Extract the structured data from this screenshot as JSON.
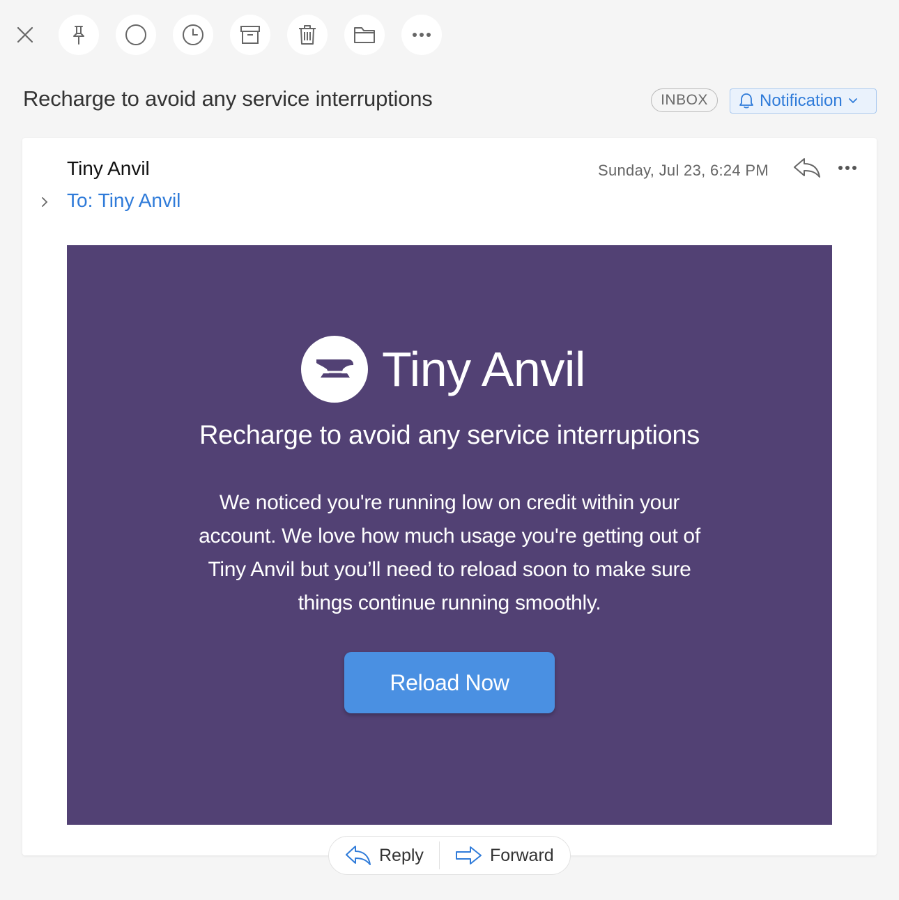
{
  "toolbar": {
    "icons": [
      "close-icon",
      "pin-icon",
      "circle-icon",
      "clock-icon",
      "archive-icon",
      "trash-icon",
      "folder-icon",
      "more-icon"
    ]
  },
  "subject": "Recharge to avoid any service interruptions",
  "labels": {
    "inbox": "INBOX",
    "notification": "Notification"
  },
  "message": {
    "sender": "Tiny Anvil",
    "to": "To: Tiny Anvil",
    "date": "Sunday, Jul 23, 6:24 PM"
  },
  "email": {
    "brand_name": "Tiny Anvil",
    "heading": "Recharge to avoid any service interruptions",
    "paragraph": "We noticed you're running low on credit within your account. We love how much usage you're getting out of Tiny Anvil but you’ll need to reload soon to make sure things continue running smoothly.",
    "cta_label": "Reload Now",
    "background_color": "#524174",
    "cta_color": "#4a90e2"
  },
  "actions": {
    "reply": "Reply",
    "forward": "Forward"
  },
  "colors": {
    "accent": "#2f7bd9",
    "background": "#f5f5f5"
  }
}
